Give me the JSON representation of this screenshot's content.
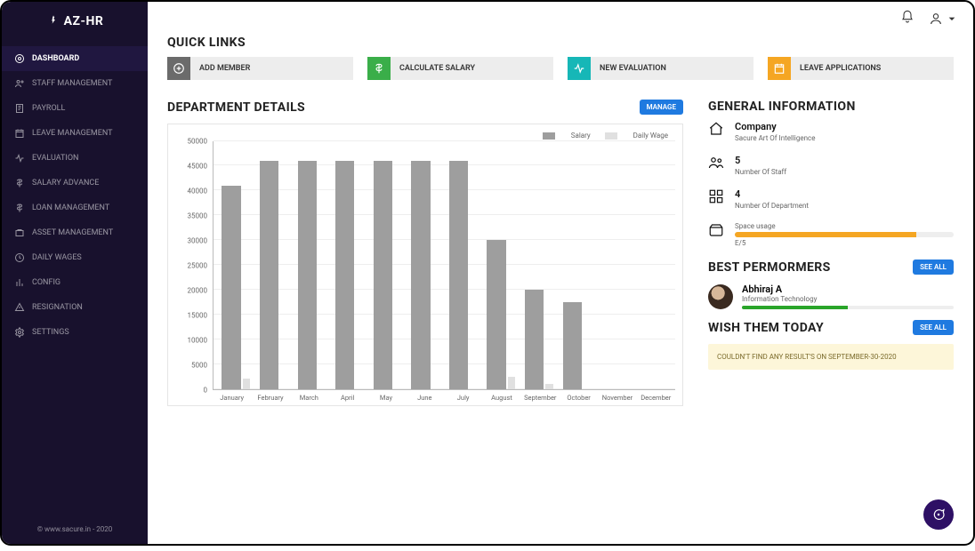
{
  "brand": "AZ-HR",
  "sidebar": {
    "items": [
      {
        "label": "DASHBOARD",
        "active": true
      },
      {
        "label": "STAFF MANAGEMENT"
      },
      {
        "label": "PAYROLL"
      },
      {
        "label": "LEAVE MANAGEMENT"
      },
      {
        "label": "EVALUATION"
      },
      {
        "label": "SALARY ADVANCE"
      },
      {
        "label": "LOAN MANAGEMENT"
      },
      {
        "label": "ASSET MANAGEMENT"
      },
      {
        "label": "DAILY WAGES"
      },
      {
        "label": "CONFIG"
      },
      {
        "label": "RESIGNATION"
      },
      {
        "label": "SETTINGS"
      }
    ],
    "footer": "© www.sacure.in - 2020"
  },
  "sections": {
    "quick_links": "QUICK LINKS",
    "department_details": "DEPARTMENT DETAILS",
    "general_info": "GENERAL INFORMATION",
    "best_performers": "BEST PERMORMERS",
    "wish_today": "WISH THEM TODAY"
  },
  "quick_links": [
    {
      "label": "ADD MEMBER",
      "color": "c-gray"
    },
    {
      "label": "CALCULATE SALARY",
      "color": "c-green"
    },
    {
      "label": "NEW EVALUATION",
      "color": "c-teal"
    },
    {
      "label": "LEAVE APPLICATIONS",
      "color": "c-amber"
    }
  ],
  "buttons": {
    "manage": "MANAGE",
    "see_all": "SEE ALL"
  },
  "chart_data": {
    "type": "bar",
    "title": "",
    "xlabel": "",
    "ylabel": "",
    "ylim": [
      0,
      50000
    ],
    "yticks": [
      0,
      5000,
      10000,
      15000,
      20000,
      25000,
      30000,
      35000,
      40000,
      45000,
      50000
    ],
    "categories": [
      "January",
      "February",
      "March",
      "April",
      "May",
      "June",
      "July",
      "August",
      "September",
      "October",
      "November",
      "December"
    ],
    "series": [
      {
        "name": "Salary",
        "color": "#9e9e9e",
        "values": [
          41000,
          46000,
          46000,
          46000,
          46000,
          46000,
          46000,
          30000,
          20000,
          17500,
          0,
          0
        ]
      },
      {
        "name": "Daily Wage",
        "color": "#e0e0e0",
        "values": [
          2000,
          0,
          0,
          0,
          0,
          0,
          0,
          2500,
          1000,
          0,
          0,
          0
        ]
      }
    ],
    "legend": [
      "Salary",
      "Daily Wage"
    ]
  },
  "general_info": {
    "company": {
      "value": "Company",
      "sub": "Sacure Art Of Intelligence"
    },
    "staff": {
      "value": "5",
      "sub": "Number Of Staff"
    },
    "departments": {
      "value": "4",
      "sub": "Number Of Department"
    },
    "space": {
      "label": "Space usage",
      "usage": "E/5",
      "pct": 83
    }
  },
  "performers": [
    {
      "name": "Abhiraj A",
      "dept": "Information Technology",
      "pct": 50
    }
  ],
  "wish_alert": "COULDN'T FIND ANY RESULT'S ON SEPTEMBER-30-2020"
}
